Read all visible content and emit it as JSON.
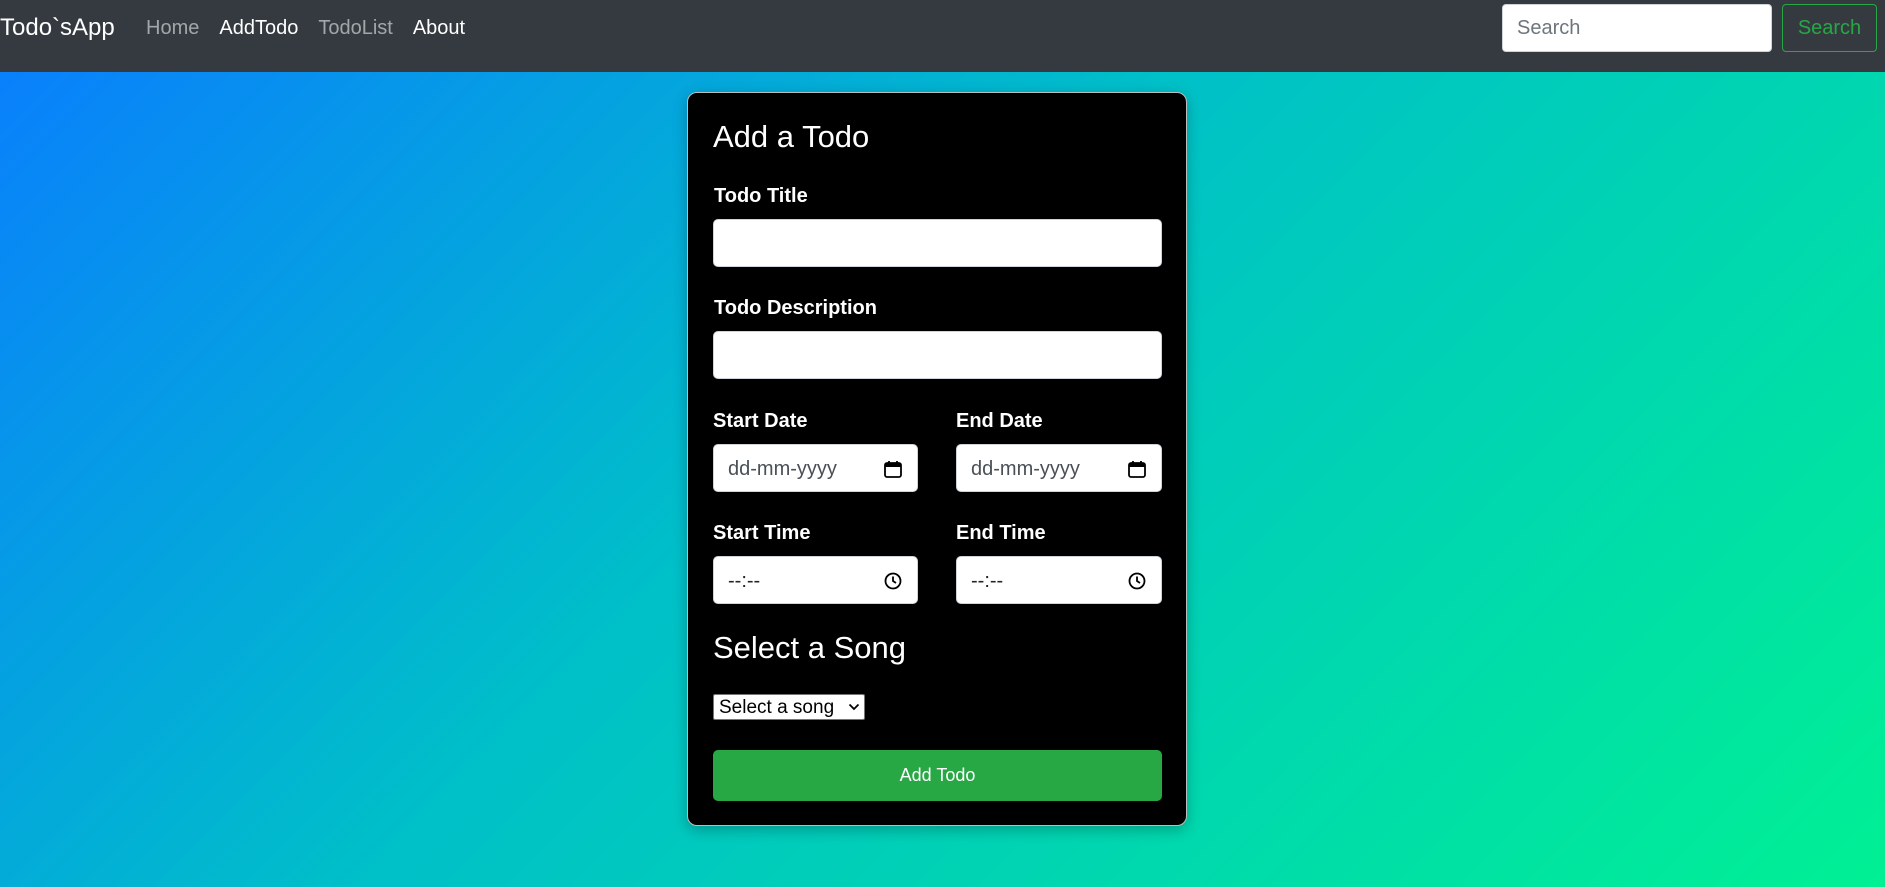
{
  "navbar": {
    "brand": "Todo`sApp",
    "links": [
      {
        "label": "Home",
        "state": "muted"
      },
      {
        "label": "AddTodo",
        "state": "active"
      },
      {
        "label": "TodoList",
        "state": "muted"
      },
      {
        "label": "About",
        "state": "active"
      }
    ],
    "search": {
      "placeholder": "Search",
      "button_label": "Search"
    }
  },
  "form": {
    "title": "Add a Todo",
    "todo_title_label": "Todo Title",
    "todo_title_value": "",
    "todo_description_label": "Todo Description",
    "todo_description_value": "",
    "start_date_label": "Start Date",
    "start_date_placeholder": "dd-mm-yyyy",
    "end_date_label": "End Date",
    "end_date_placeholder": "dd-mm-yyyy",
    "start_time_label": "Start Time",
    "start_time_placeholder": "--:--",
    "end_time_label": "End Time",
    "end_time_placeholder": "--:--",
    "song_heading": "Select a Song",
    "song_select_value": "Select a song",
    "submit_label": "Add Todo"
  },
  "icons": {
    "calendar": "calendar-icon",
    "clock": "clock-icon",
    "chevron": "chevron-down-icon"
  },
  "colors": {
    "navbar_bg": "#343a40",
    "accent_green": "#28a745",
    "card_bg": "#000000",
    "gradient_start": "#0a7cff",
    "gradient_end": "#00f094"
  }
}
